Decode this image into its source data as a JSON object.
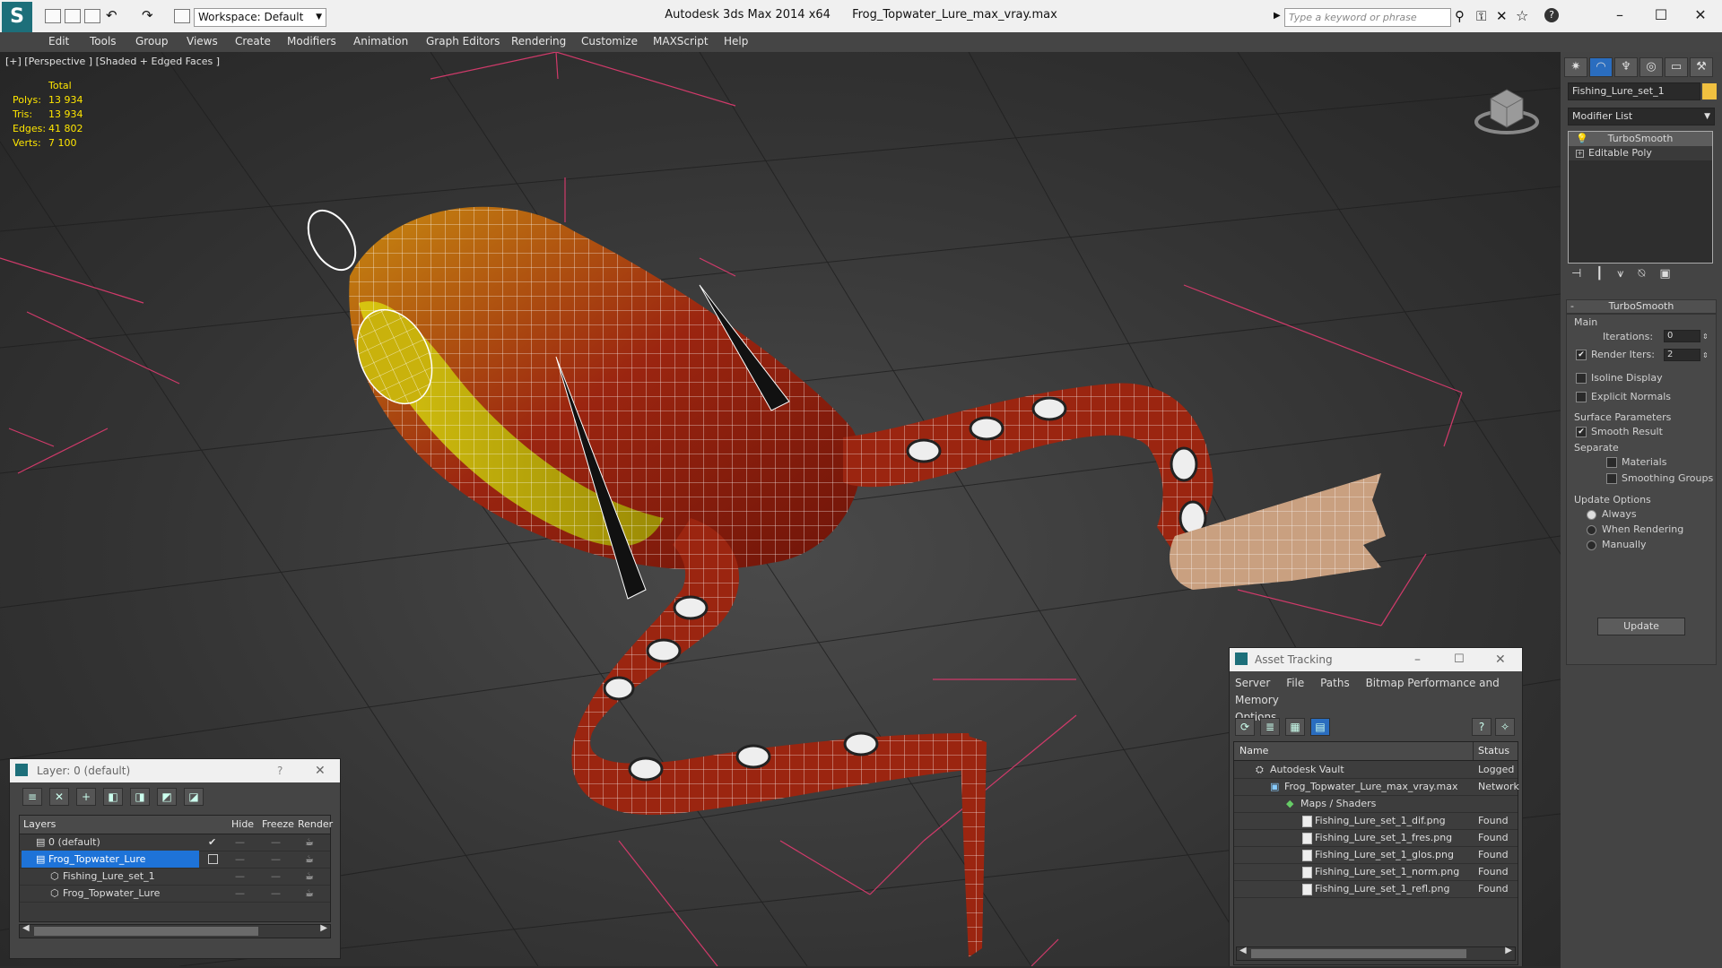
{
  "titlebar": {
    "app": "Autodesk 3ds Max  2014 x64",
    "file": "Frog_Topwater_Lure_max_vray.max",
    "workspace": "Workspace: Default",
    "search_placeholder": "Type a keyword or phrase"
  },
  "menu": [
    "Edit",
    "Tools",
    "Group",
    "Views",
    "Create",
    "Modifiers",
    "Animation",
    "Graph Editors",
    "Rendering",
    "Customize",
    "MAXScript",
    "Help"
  ],
  "viewport": {
    "label": "[+] [Perspective ] [Shaded + Edged Faces ]",
    "stats_header": "Total",
    "stats": [
      {
        "key": "Polys:",
        "value": "13 934"
      },
      {
        "key": "Tris:",
        "value": "13 934"
      },
      {
        "key": "Edges:",
        "value": "41 802"
      },
      {
        "key": "Verts:",
        "value": "7 100"
      }
    ]
  },
  "command_panel": {
    "object_name": "Fishing_Lure_set_1",
    "object_color": "#f0c040",
    "modifier_list": "Modifier List",
    "stack": [
      "TurboSmooth",
      "Editable Poly"
    ],
    "rollout_title": "TurboSmooth",
    "main_label": "Main",
    "iterations_label": "Iterations:",
    "iterations_value": "0",
    "render_iters_label": "Render Iters:",
    "render_iters_value": "2",
    "isoline": "Isoline Display",
    "explicit_normals": "Explicit Normals",
    "surface_params": "Surface Parameters",
    "smooth_result": "Smooth Result",
    "separate": "Separate",
    "materials": "Materials",
    "smoothing_groups": "Smoothing Groups",
    "update_options": "Update Options",
    "always": "Always",
    "when_rendering": "When Rendering",
    "manually": "Manually",
    "update_button": "Update"
  },
  "layer_dialog": {
    "title": "Layer: 0 (default)",
    "help": "?",
    "columns": [
      "Layers",
      "Hide",
      "Freeze",
      "Render"
    ],
    "rows": [
      {
        "name": "0 (default)",
        "indent": 0,
        "selected": false,
        "check": "✔"
      },
      {
        "name": "Frog_Topwater_Lure",
        "indent": 0,
        "selected": true,
        "check": ""
      },
      {
        "name": "Fishing_Lure_set_1",
        "indent": 1,
        "selected": false,
        "check": ""
      },
      {
        "name": "Frog_Topwater_Lure",
        "indent": 1,
        "selected": false,
        "check": ""
      }
    ]
  },
  "asset_dialog": {
    "title": "Asset Tracking",
    "menu": [
      "Server",
      "File",
      "Paths",
      "Bitmap Performance and Memory",
      "Options"
    ],
    "columns": [
      "Name",
      "Status"
    ],
    "rows": [
      {
        "name": "Autodesk Vault",
        "status": "Logged",
        "level": 1
      },
      {
        "name": "Frog_Topwater_Lure_max_vray.max",
        "status": "Network",
        "level": 2
      },
      {
        "name": "Maps / Shaders",
        "status": "",
        "level": 3
      },
      {
        "name": "Fishing_Lure_set_1_dif.png",
        "status": "Found",
        "level": 4
      },
      {
        "name": "Fishing_Lure_set_1_fres.png",
        "status": "Found",
        "level": 4
      },
      {
        "name": "Fishing_Lure_set_1_glos.png",
        "status": "Found",
        "level": 4
      },
      {
        "name": "Fishing_Lure_set_1_norm.png",
        "status": "Found",
        "level": 4
      },
      {
        "name": "Fishing_Lure_set_1_refl.png",
        "status": "Found",
        "level": 4
      }
    ]
  }
}
